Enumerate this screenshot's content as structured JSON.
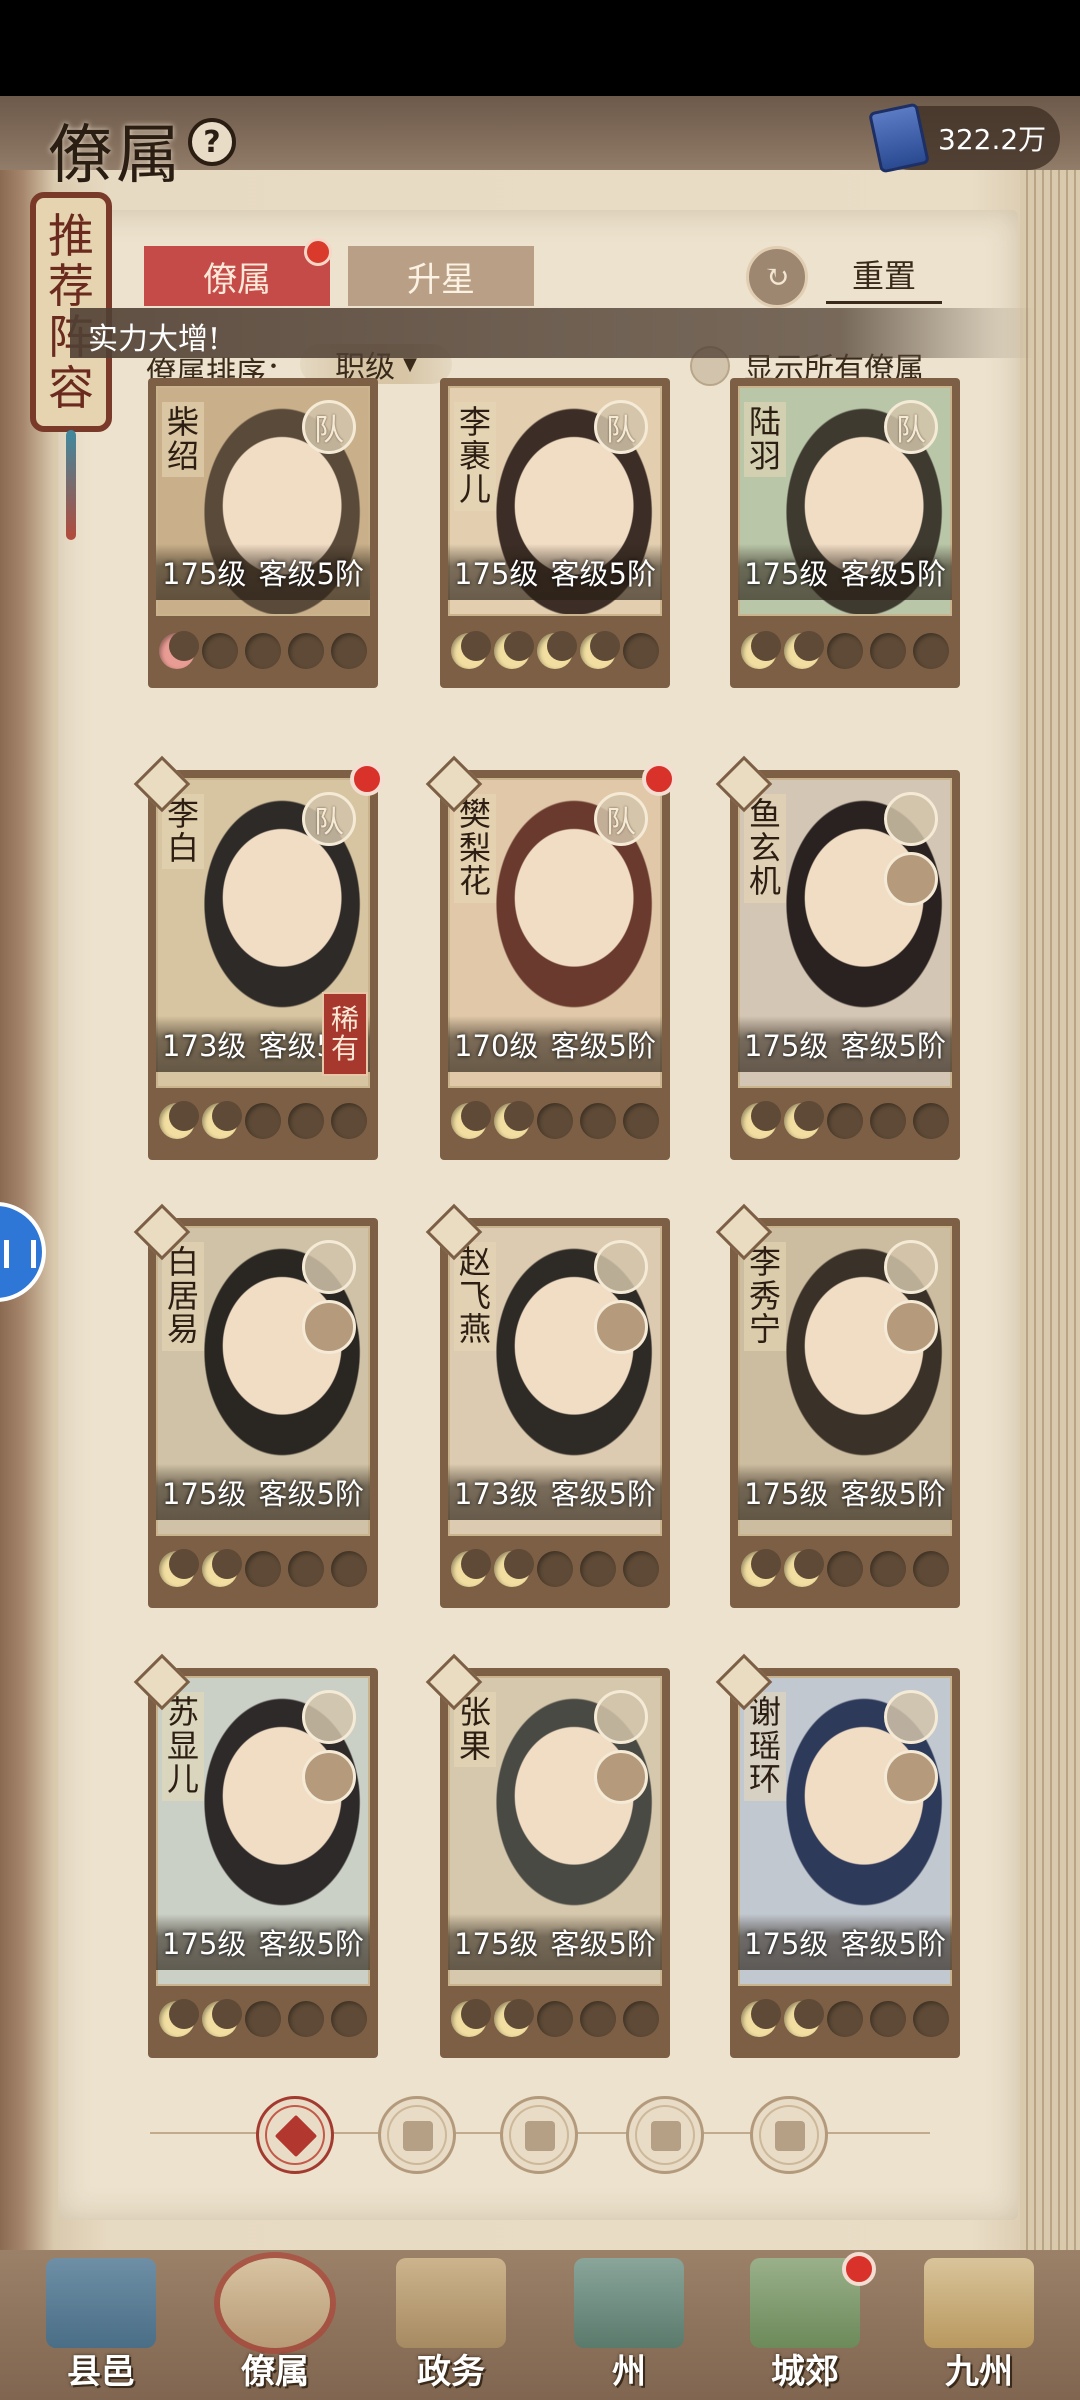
{
  "header": {
    "title": "僚属",
    "currency_value": "322.2万"
  },
  "side_scroll": {
    "chars": [
      "推",
      "荐",
      "阵",
      "容"
    ]
  },
  "tabs": [
    {
      "label": "僚属",
      "active": true
    },
    {
      "label": "升星",
      "active": false
    }
  ],
  "reset_label": "重置",
  "toast": "实力大增!",
  "sort": {
    "label": "僚属排序：",
    "value": "职级"
  },
  "show_all_label": "显示所有僚属",
  "cards": [
    {
      "name": [
        "柴",
        "绍"
      ],
      "level": "175级",
      "grade": "客级5阶",
      "moons": [
        "red",
        "off",
        "off",
        "off",
        "off"
      ],
      "badge": "队"
    },
    {
      "name": [
        "李",
        "裹",
        "儿"
      ],
      "level": "175级",
      "grade": "客级5阶",
      "moons": [
        "on",
        "on",
        "on",
        "on",
        "off"
      ],
      "badge": "队"
    },
    {
      "name": [
        "陆",
        "羽"
      ],
      "level": "175级",
      "grade": "客级5阶",
      "moons": [
        "on",
        "on",
        "off",
        "off",
        "off"
      ],
      "badge": "队"
    },
    {
      "name": [
        "李",
        "白"
      ],
      "level": "173级",
      "grade": "客级5阶",
      "moons": [
        "on",
        "on",
        "off",
        "off",
        "off"
      ],
      "badge": "队",
      "rare": [
        "稀",
        "有"
      ]
    },
    {
      "name": [
        "樊",
        "梨",
        "花"
      ],
      "level": "170级",
      "grade": "客级5阶",
      "moons": [
        "on",
        "on",
        "off",
        "off",
        "off"
      ],
      "badge": "队"
    },
    {
      "name": [
        "鱼",
        "玄",
        "机"
      ],
      "level": "175级",
      "grade": "客级5阶",
      "moons": [
        "on",
        "on",
        "off",
        "off",
        "off"
      ],
      "badge": ""
    },
    {
      "name": [
        "白",
        "居",
        "易"
      ],
      "level": "175级",
      "grade": "客级5阶",
      "moons": [
        "on",
        "on",
        "off",
        "off",
        "off"
      ],
      "badge": ""
    },
    {
      "name": [
        "赵",
        "飞",
        "燕"
      ],
      "level": "173级",
      "grade": "客级5阶",
      "moons": [
        "on",
        "on",
        "off",
        "off",
        "off"
      ],
      "badge": ""
    },
    {
      "name": [
        "李",
        "秀",
        "宁"
      ],
      "level": "175级",
      "grade": "客级5阶",
      "moons": [
        "on",
        "on",
        "off",
        "off",
        "off"
      ],
      "badge": ""
    },
    {
      "name": [
        "苏",
        "显",
        "儿"
      ],
      "level": "175级",
      "grade": "客级5阶",
      "moons": [
        "on",
        "on",
        "off",
        "off",
        "off"
      ],
      "badge": ""
    },
    {
      "name": [
        "张",
        "果"
      ],
      "level": "175级",
      "grade": "客级5阶",
      "moons": [
        "on",
        "on",
        "off",
        "off",
        "off"
      ],
      "badge": ""
    },
    {
      "name": [
        "谢",
        "瑶",
        "环"
      ],
      "level": "175级",
      "grade": "客级5阶",
      "moons": [
        "on",
        "on",
        "off",
        "off",
        "off"
      ],
      "badge": ""
    }
  ],
  "bottom_nav": [
    {
      "label": "县邑"
    },
    {
      "label": "僚属"
    },
    {
      "label": "政务"
    },
    {
      "label": "州"
    },
    {
      "label": "城郊"
    },
    {
      "label": "九州"
    }
  ],
  "colors": {
    "accent_red": "#c44b48",
    "page_bg": "#ece2cd",
    "card_frame": "#7c5f45",
    "moon_on": "#f1dea0"
  }
}
